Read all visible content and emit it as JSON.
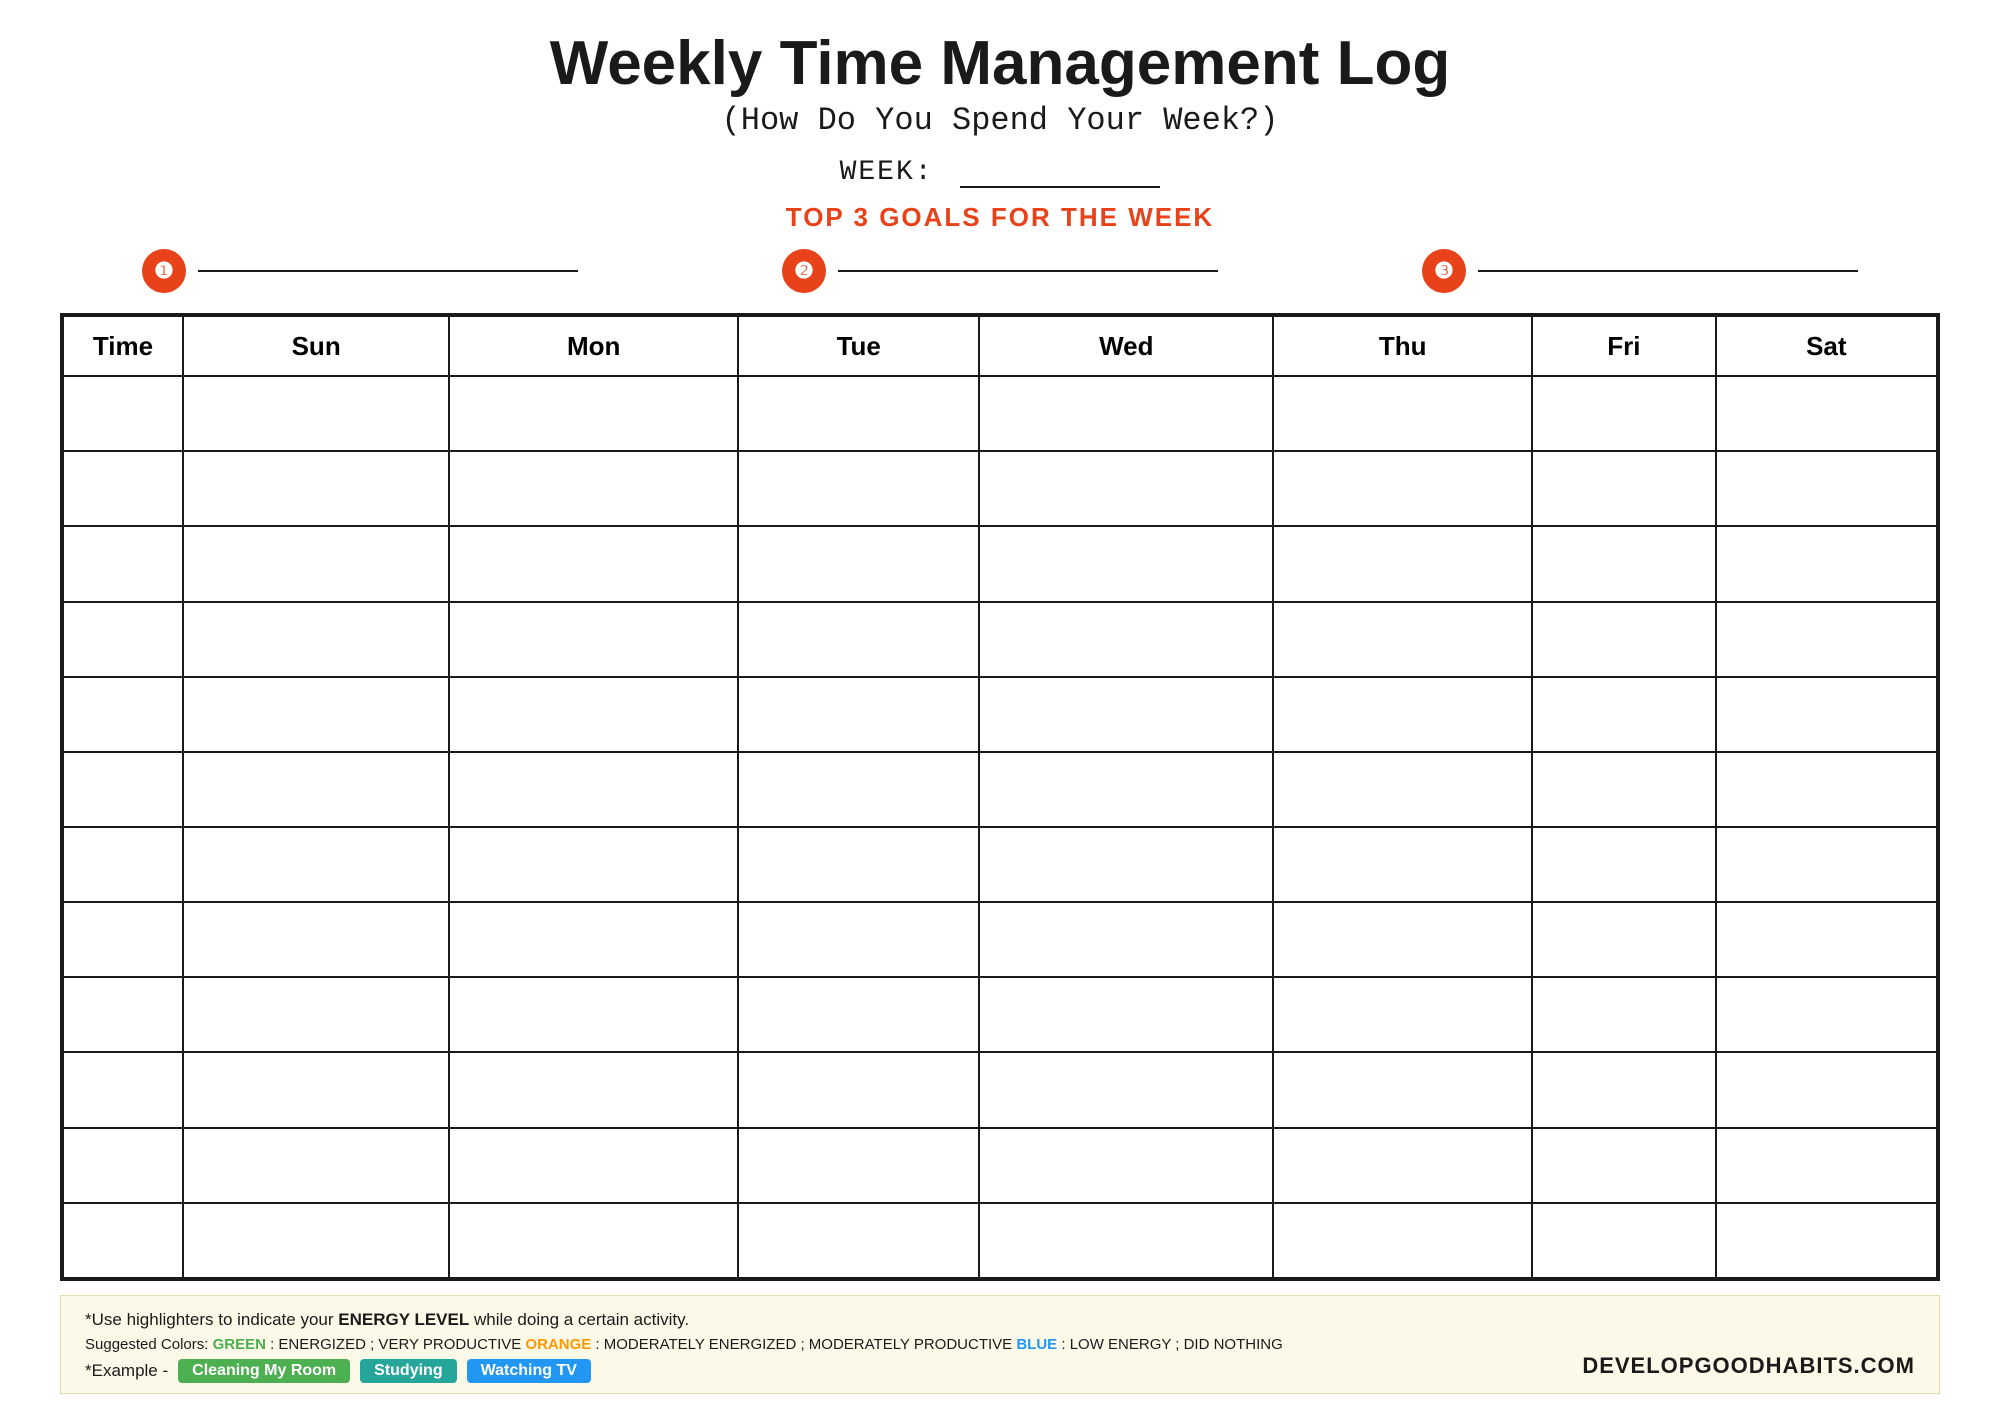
{
  "header": {
    "title": "Weekly Time Management Log",
    "subtitle": "(How Do You Spend Your Week?)",
    "week_label": "WEEK:",
    "goals_title": "TOP 3 GOALS FOR THE WEEK"
  },
  "goals": [
    {
      "number": "❶",
      "id": 1
    },
    {
      "number": "❷",
      "id": 2
    },
    {
      "number": "❸",
      "id": 3
    }
  ],
  "table": {
    "headers": [
      "Time",
      "Sun",
      "Mon",
      "Tue",
      "Wed",
      "Thu",
      "Fri",
      "Sat"
    ],
    "row_count": 12
  },
  "footer": {
    "line1_prefix": "*Use highlighters to indicate your ",
    "line1_bold": "ENERGY LEVEL",
    "line1_suffix": " while doing a certain activity.",
    "line2_prefix": "Suggested Colors:  ",
    "green_label": "GREEN",
    "green_desc": " : ENERGIZED ; VERY PRODUCTIVE  ",
    "orange_label": "ORANGE",
    "orange_desc": " : MODERATELY ENERGIZED ; MODERATELY PRODUCTIVE  ",
    "blue_label": "BLUE",
    "blue_desc": " : LOW ENERGY ; DID NOTHING",
    "example_prefix": "*Example -",
    "badge1": "Cleaning My Room",
    "badge2": "Studying",
    "badge3": "Watching TV"
  },
  "brand": "DEVELOPGOODHABITS.COM"
}
